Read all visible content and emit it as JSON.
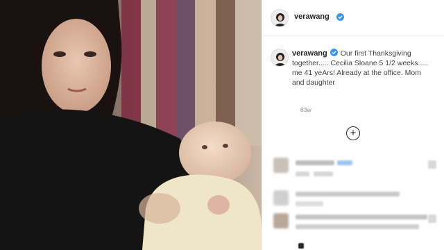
{
  "post": {
    "username": "verawang",
    "verified": true,
    "caption": "Our first Thanksgiving together..... Cecilia Sloane 5 1/2 weeks..... me 41 yeArs! Already at the office. Mom and daughter",
    "timestamp": "83w"
  },
  "icons": {
    "verified": "verified-badge-icon",
    "add_comment": "plus-circle-icon"
  },
  "colors": {
    "verified_blue": "#3897f0",
    "text": "#262626",
    "muted": "#8e8e8e",
    "border": "#efefef"
  }
}
